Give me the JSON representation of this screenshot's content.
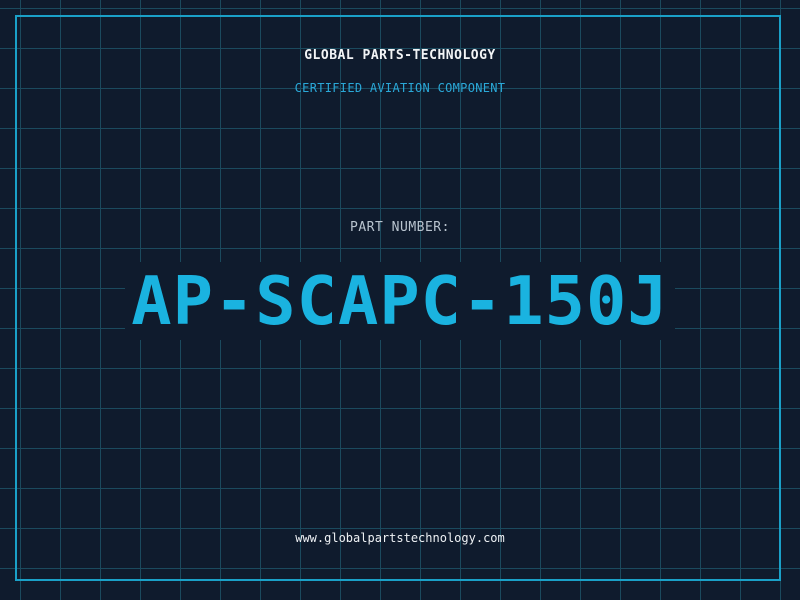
{
  "header": {
    "company": "GLOBAL PARTS-TECHNOLOGY",
    "tagline": "CERTIFIED AVIATION COMPONENT"
  },
  "part": {
    "label": "PART NUMBER:",
    "number": "AP-SCAPC-150J"
  },
  "footer": {
    "website": "www.globalpartstechnology.com"
  },
  "colors": {
    "background": "#0f1b2d",
    "grid": "#1b4a5e",
    "accent": "#1ab3e0",
    "frame": "#1aa0c8"
  }
}
